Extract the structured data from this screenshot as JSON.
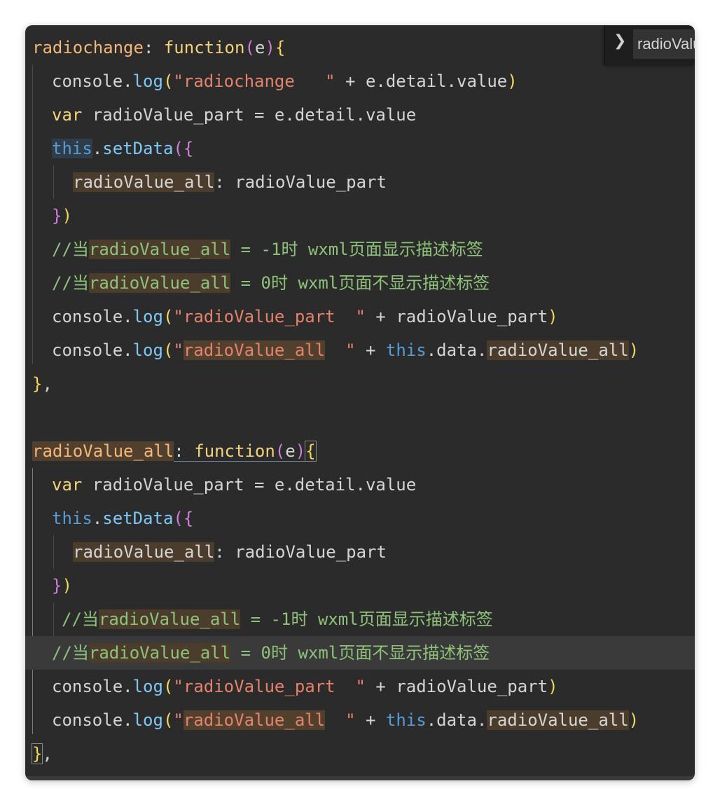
{
  "breadcrumb": {
    "label": "radioValue_all"
  },
  "block1": {
    "name": "radiochange",
    "colon": ": ",
    "fn_kw": "function",
    "param": "e",
    "log1_str": "\"radiochange   \"",
    "log1_rest": " + e.detail.value",
    "var_line": "var radioValue_part = e.detail.value",
    "var_kw": "var",
    "var_rest": " radioValue_part = e.detail.value",
    "this_kw": "this",
    "setData": "setData",
    "prop": "radioValue_all",
    "prop_rest": ": radioValue_part",
    "comment_prefix": "//当",
    "comment1_suffix": " = -1时 wxml页面显示描述标签",
    "comment2_suffix": " = 0时 wxml页面不显示描述标签",
    "console": "console",
    "log": "log",
    "log2_str": "\"radioValue_part  \"",
    "log2_rest": " + radioValue_part",
    "log3_str_a": "\"",
    "log3_str_b": "radioValue_all",
    "log3_str_c": "  \"",
    "log3_mid": " + ",
    "log3_tail_a": ".data.",
    "log3_tail_b": "radioValue_all",
    "close": "},"
  },
  "block2": {
    "name": "radioValue_all"
  },
  "colors": {
    "editor_bg": "#2b2b2b",
    "comment": "#8ec27a",
    "string": "#e4826b",
    "keyword": "#f3d37a",
    "this": "#569cd6",
    "method": "#7fc8f8"
  }
}
